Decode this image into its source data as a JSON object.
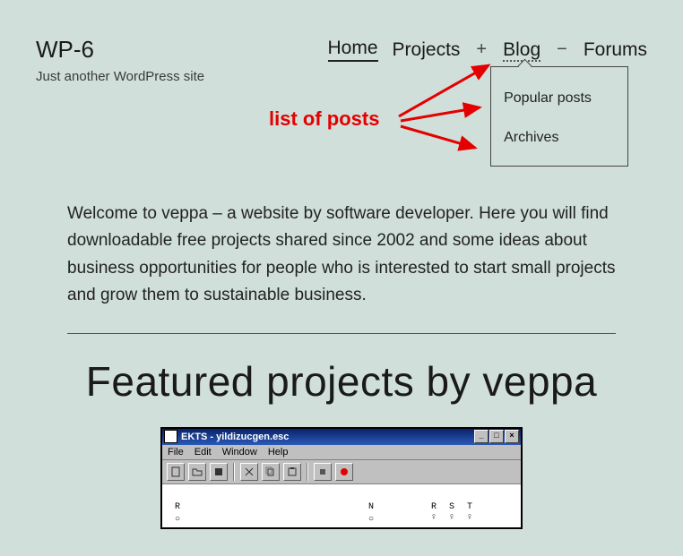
{
  "site": {
    "title": "WP-6",
    "tagline": "Just another WordPress site"
  },
  "nav": {
    "home": "Home",
    "projects": "Projects",
    "expand": "+",
    "blog": "Blog",
    "collapse": "−",
    "forums": "Forums",
    "dropdown": {
      "popular": "Popular posts",
      "archives": "Archives"
    }
  },
  "annotation": {
    "label": "list of posts"
  },
  "intro": "Welcome to veppa – a website by software developer. Here you will find downloadable free projects shared since 2002 and some ideas about business opportunities for people who is interested to start small projects and grow them to sustainable business.",
  "featured_heading": "Featured projects by veppa",
  "ekts": {
    "title": "EKTS - yildizucgen.esc",
    "menu": {
      "file": "File",
      "edit": "Edit",
      "window": "Window",
      "help": "Help"
    },
    "canvas": {
      "r": "R",
      "n": "N",
      "rst": "R S T",
      "qqq": "♀ ♀ ♀"
    }
  }
}
